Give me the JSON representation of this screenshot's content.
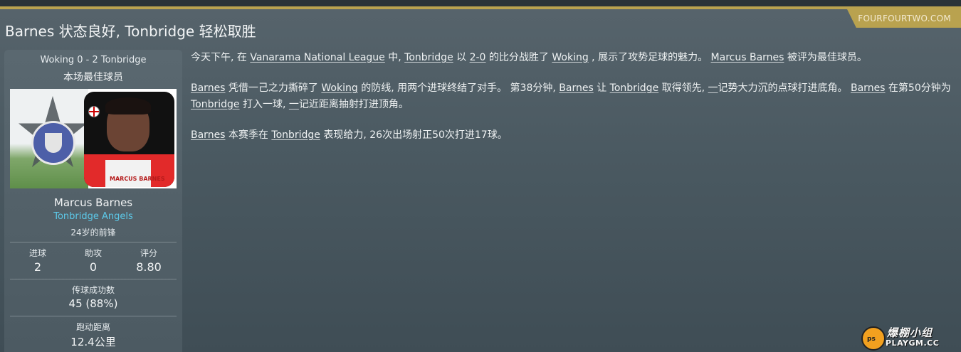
{
  "source": "FOURFOURTWO.COM",
  "headline": "Barnes 状态良好, Tonbridge 轻松取胜",
  "card": {
    "result": "Woking 0 - 2 Tonbridge",
    "award": "本场最佳球员",
    "shirt_text": "MARCUS BARNES",
    "player_name": "Marcus Barnes",
    "club": "Tonbridge Angels",
    "position": "24岁的前锋",
    "stats": [
      {
        "label": "进球",
        "value": "2"
      },
      {
        "label": "助攻",
        "value": "0"
      },
      {
        "label": "评分",
        "value": "8.80"
      }
    ],
    "passes": {
      "label": "传球成功数",
      "value": "45 (88%)"
    },
    "distance": {
      "label": "跑动距离",
      "value": "12.4公里"
    }
  },
  "article": {
    "p1": {
      "t1": "今天下午, 在 ",
      "l1": "Vanarama National League",
      "t2": " 中, ",
      "l2": "Tonbridge",
      "t3": " 以 ",
      "l3": "2-0",
      "t4": " 的比分战胜了 ",
      "l4": "Woking",
      "t5": " , 展示了攻势足球的魅力。 ",
      "l5": "Marcus Barnes",
      "t6": " 被评为最佳球员。"
    },
    "p2": {
      "l1": "Barnes",
      "t1": " 凭借一己之力撕碎了 ",
      "l2": "Woking",
      "t2": " 的防线, 用两个进球终结了对手。 第38分钟, ",
      "l3": "Barnes",
      "t3": " 让 ",
      "l4": "Tonbridge",
      "t4": " 取得领先, ",
      "l5": "一",
      "t5": "记势大力沉的点球打进底角。 ",
      "l6": "Barnes",
      "t6": " 在第50分钟为 ",
      "l7": "Tonbridge",
      "t7": " 打入一球, ",
      "l8": "一",
      "t8": "记近距离抽射打进顶角。"
    },
    "p3": {
      "l1": "Barnes",
      "t1": " 本赛季在 ",
      "l2": "Tonbridge",
      "t2": " 表现给力, 26次出场射正50次打进17球。"
    }
  },
  "watermark": {
    "top": "爆棚小组",
    "bottom": "PLAYGM.CC",
    "logo_text": "ps"
  }
}
